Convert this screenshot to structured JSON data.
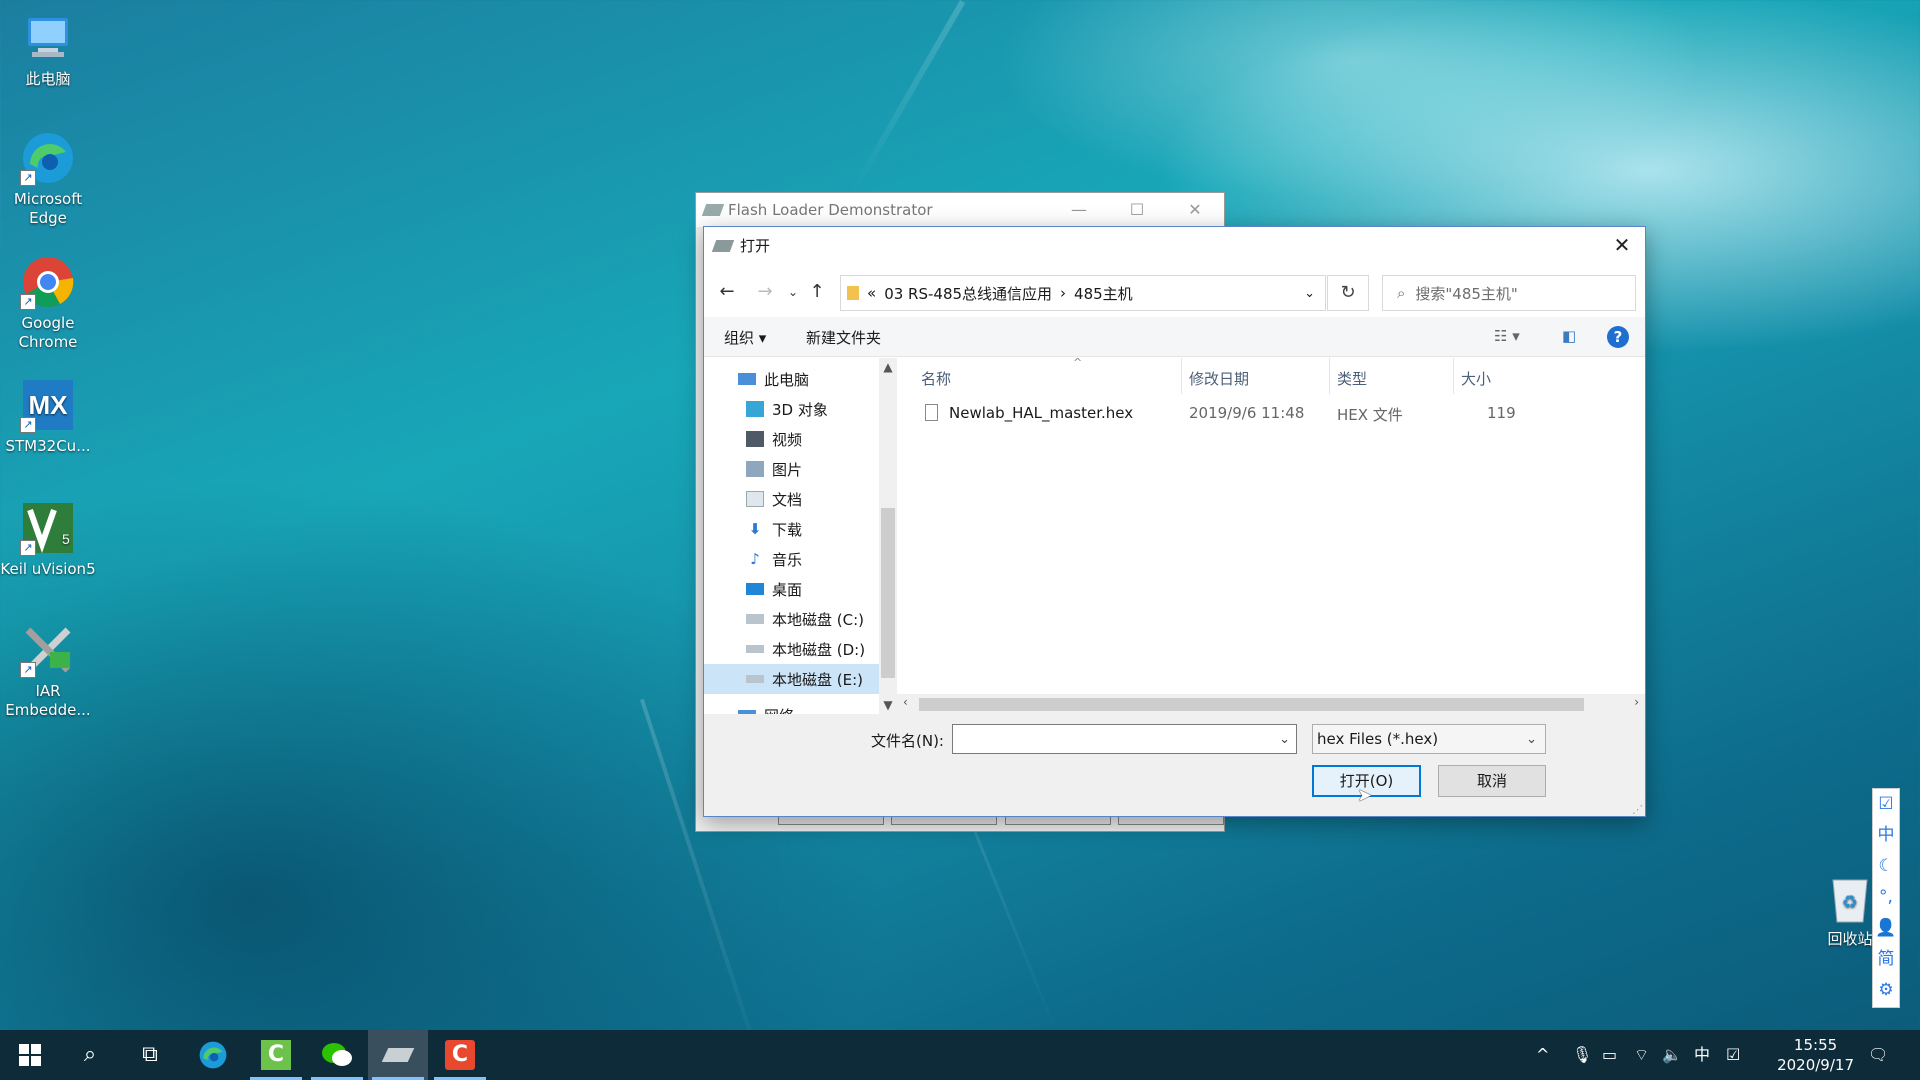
{
  "desktop": {
    "icons": [
      {
        "label": "此电脑",
        "icon": "computer-icon"
      },
      {
        "label": "Microsoft Edge",
        "icon": "edge-icon"
      },
      {
        "label": "Google Chrome",
        "icon": "chrome-icon"
      },
      {
        "label": "STM32Cu...",
        "icon": "stm32cubemx-icon"
      },
      {
        "label": "Keil uVision5",
        "icon": "keil-icon"
      },
      {
        "label": "IAR Embedde...",
        "icon": "iar-icon"
      }
    ],
    "recycle_bin": "回收站"
  },
  "flash_loader": {
    "title": "Flash Loader Demonstrator",
    "minimize": "—",
    "maximize": "☐",
    "close": "✕"
  },
  "dialog": {
    "title": "打开",
    "close": "✕",
    "address": {
      "overflow": "«",
      "crumbs": [
        "03 RS-485总线通信应用",
        "485主机"
      ],
      "separator": "›"
    },
    "search_placeholder": "搜索\"485主机\"",
    "toolbar": {
      "organize": "组织 ▾",
      "new_folder": "新建文件夹",
      "help": "?"
    },
    "tree": [
      {
        "label": "此电脑",
        "icon": "computer-icon",
        "selected": false
      },
      {
        "label": "3D 对象",
        "icon": "3d-objects-icon",
        "selected": false
      },
      {
        "label": "视频",
        "icon": "video-icon",
        "selected": false
      },
      {
        "label": "图片",
        "icon": "pictures-icon",
        "selected": false
      },
      {
        "label": "文档",
        "icon": "documents-icon",
        "selected": false
      },
      {
        "label": "下载",
        "icon": "download-icon",
        "selected": false
      },
      {
        "label": "音乐",
        "icon": "music-icon",
        "selected": false
      },
      {
        "label": "桌面",
        "icon": "desktop-icon",
        "selected": false
      },
      {
        "label": "本地磁盘 (C:)",
        "icon": "drive-icon",
        "selected": false
      },
      {
        "label": "本地磁盘 (D:)",
        "icon": "drive-icon",
        "selected": false
      },
      {
        "label": "本地磁盘 (E:)",
        "icon": "drive-icon",
        "selected": true
      },
      {
        "label": "网络",
        "icon": "network-icon",
        "selected": false
      }
    ],
    "columns": [
      "名称",
      "修改日期",
      "类型",
      "大小"
    ],
    "files": [
      {
        "name": "Newlab_HAL_master.hex",
        "date": "2019/9/6 11:48",
        "type": "HEX 文件",
        "size": "119"
      }
    ],
    "filename_label": "文件名(N):",
    "filename_value": "",
    "filter": "hex Files (*.hex)",
    "open_button": "打开(O)",
    "cancel_button": "取消"
  },
  "taskbar": {
    "items": [
      "start-icon",
      "search-icon",
      "task-view-icon",
      "edge-icon",
      "app-green-icon",
      "wechat-icon",
      "flash-loader-icon",
      "app-red-icon"
    ],
    "ime_lang": "中",
    "time": "15:55",
    "date": "2020/9/17"
  },
  "ime_toolbar": [
    "☑",
    "中",
    "☾",
    "°,",
    "👤",
    "简",
    "⚙"
  ]
}
